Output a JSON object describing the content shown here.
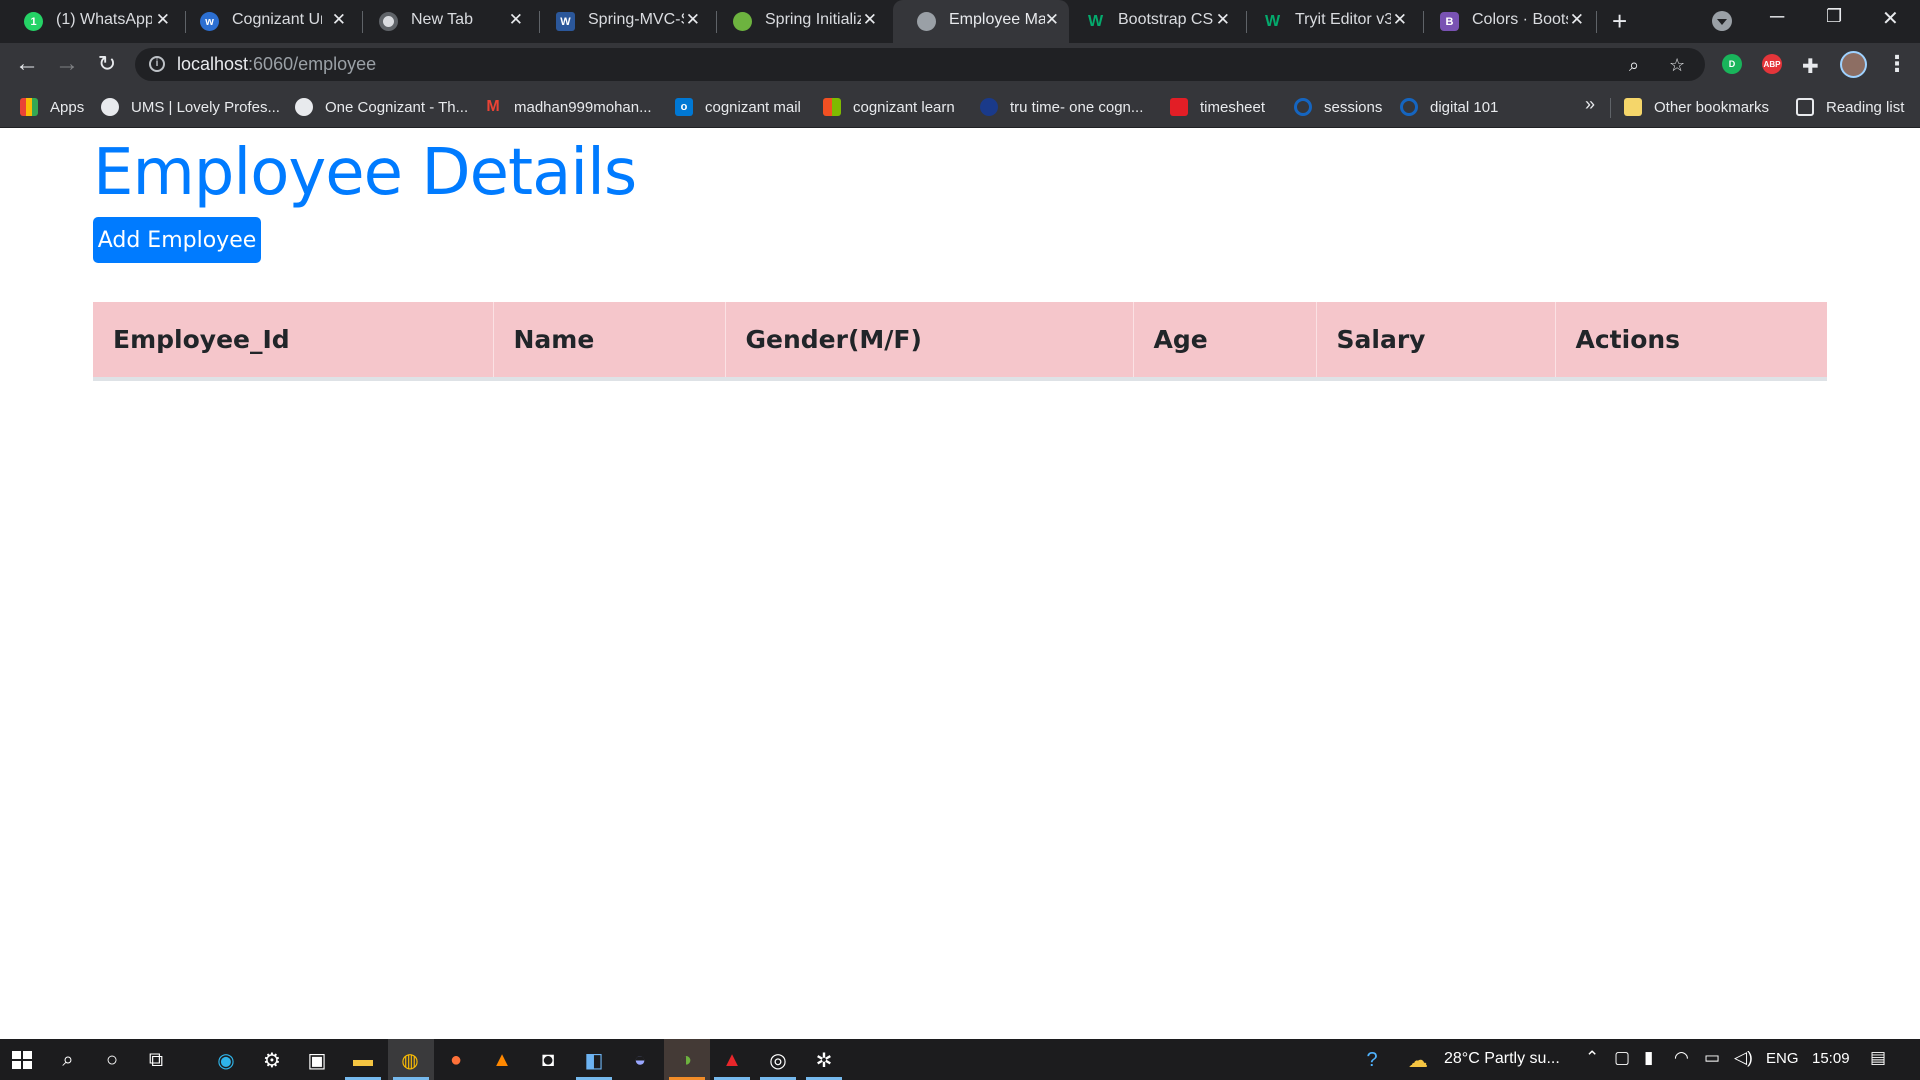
{
  "browser": {
    "tabs": [
      {
        "title": "(1) WhatsApp",
        "favicon": "whatsapp-icon",
        "favicon_color": "#25d366",
        "favicon_glyph": "1",
        "active": false
      },
      {
        "title": "Cognizant Uni",
        "favicon": "cognizant-icon",
        "favicon_color": "#2c6fd1",
        "favicon_glyph": "w",
        "active": false
      },
      {
        "title": "New Tab",
        "favicon": "chrome-icon",
        "favicon_color": "#dadce0",
        "favicon_glyph": "",
        "active": false
      },
      {
        "title": "Spring-MVC-S",
        "favicon": "word-icon",
        "favicon_color": "#2b579a",
        "favicon_glyph": "W",
        "active": false
      },
      {
        "title": "Spring Initializ",
        "favicon": "spring-icon",
        "favicon_color": "#6db33f",
        "favicon_glyph": "",
        "active": false
      },
      {
        "title": "Employee Mar",
        "favicon": "globe-icon",
        "favicon_color": "#9aa0a6",
        "favicon_glyph": "",
        "active": true
      },
      {
        "title": "Bootstrap CSS",
        "favicon": "w3schools-icon",
        "favicon_color": "#04aa6d",
        "favicon_glyph": "W",
        "active": false
      },
      {
        "title": "Tryit Editor v3",
        "favicon": "w3schools-icon",
        "favicon_color": "#04aa6d",
        "favicon_glyph": "W",
        "active": false
      },
      {
        "title": "Colors · Boots",
        "favicon": "bootstrap-icon",
        "favicon_color": "#7952b3",
        "favicon_glyph": "B",
        "active": false
      }
    ],
    "address": {
      "host": "localhost",
      "path": ":6060/employee"
    },
    "bookmarks": [
      {
        "label": "Apps",
        "icon": "apps-grid-icon",
        "color": "#4285f4"
      },
      {
        "label": "UMS | Lovely Profes...",
        "icon": "globe-icon",
        "color": "#5f6368"
      },
      {
        "label": "One Cognizant - Th...",
        "icon": "globe-icon",
        "color": "#5f6368"
      },
      {
        "label": "madhan999mohan...",
        "icon": "gmail-icon",
        "color": "#ea4335"
      },
      {
        "label": "cognizant mail",
        "icon": "outlook-icon",
        "color": "#0078d4"
      },
      {
        "label": "cognizant learn",
        "icon": "microsoft-icon",
        "color": "#f25022"
      },
      {
        "label": "tru time- one cogn...",
        "icon": "trutime-icon",
        "color": "#1a3a8a"
      },
      {
        "label": "timesheet",
        "icon": "oracle-icon",
        "color": "#e21e26"
      },
      {
        "label": "sessions",
        "icon": "c-icon",
        "color": "#1565c0"
      },
      {
        "label": "digital 101",
        "icon": "c-icon",
        "color": "#1565c0"
      }
    ],
    "other_bookmarks": "Other bookmarks",
    "reading_list": "Reading list"
  },
  "page": {
    "title": "Employee Details",
    "add_button": "Add Employee",
    "table": {
      "columns": [
        "Employee_Id",
        "Name",
        "Gender(M/F)",
        "Age",
        "Salary",
        "Actions"
      ],
      "rows": []
    },
    "colors": {
      "primary": "#007bff",
      "table_header_bg": "#f5c6cb"
    }
  },
  "taskbar": {
    "weather": "28°C  Partly su...",
    "language": "ENG",
    "time": "15:09"
  }
}
